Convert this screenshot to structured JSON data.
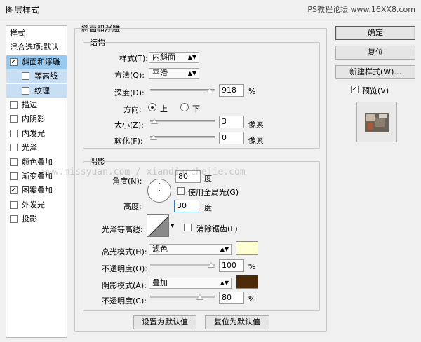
{
  "window": {
    "title": "图层样式",
    "watermark": "PS教程论坛 www.16XX8.com"
  },
  "sidebar": {
    "header": "样式",
    "blend": "混合选项:默认",
    "items": [
      {
        "label": "斜面和浮雕",
        "checked": true,
        "selected": true
      },
      {
        "label": "等高线",
        "checked": false,
        "sub": true
      },
      {
        "label": "纹理",
        "checked": false,
        "sub": true
      },
      {
        "label": "描边",
        "checked": false
      },
      {
        "label": "内阴影",
        "checked": false
      },
      {
        "label": "内发光",
        "checked": false
      },
      {
        "label": "光泽",
        "checked": false
      },
      {
        "label": "颜色叠加",
        "checked": false
      },
      {
        "label": "渐变叠加",
        "checked": false
      },
      {
        "label": "图案叠加",
        "checked": true
      },
      {
        "label": "外发光",
        "checked": false
      },
      {
        "label": "投影",
        "checked": false
      }
    ],
    "overlay_watermark": "www.missyuan.com / xiandianchejie.com"
  },
  "bevel": {
    "group_title": "斜面和浮雕",
    "structure_title": "结构",
    "style_label": "样式(T):",
    "style_value": "内斜面",
    "technique_label": "方法(Q):",
    "technique_value": "平滑",
    "depth_label": "深度(D):",
    "depth_value": "918",
    "depth_unit": "%",
    "depth_level": 0.98,
    "direction_label": "方向:",
    "dir_up": "上",
    "dir_down": "下",
    "size_label": "大小(Z):",
    "size_value": "3",
    "size_unit": "像素",
    "size_level": 0.01,
    "soften_label": "软化(F):",
    "soften_value": "0",
    "soften_unit": "像素",
    "soften_level": 0.0
  },
  "shading": {
    "title": "阴影",
    "angle_label": "角度(N):",
    "angle_value": "80",
    "angle_unit": "度",
    "global_light_label": "使用全局光(G)",
    "altitude_label": "高度:",
    "altitude_value": "30",
    "altitude_unit": "度",
    "contour_label": "光泽等高线:",
    "antialias_label": "消除锯齿(L)",
    "highlight_mode_label": "高光模式(H):",
    "highlight_mode_value": "滤色",
    "highlight_color": "#ffffd2",
    "highlight_opacity_label": "不透明度(O):",
    "highlight_opacity_value": "100",
    "highlight_opacity_level": 1.0,
    "opacity_unit": "%",
    "shadow_mode_label": "阴影模式(A):",
    "shadow_mode_value": "叠加",
    "shadow_color": "#4d2a08",
    "shadow_opacity_label": "不透明度(C):",
    "shadow_opacity_value": "80",
    "shadow_opacity_level": 0.8
  },
  "bottom": {
    "make_default": "设置为默认值",
    "reset_default": "复位为默认值"
  },
  "right": {
    "ok": "确定",
    "cancel": "复位",
    "new_style": "新建样式(W)...",
    "preview_label": "预览(V)",
    "preview_checked": true
  }
}
